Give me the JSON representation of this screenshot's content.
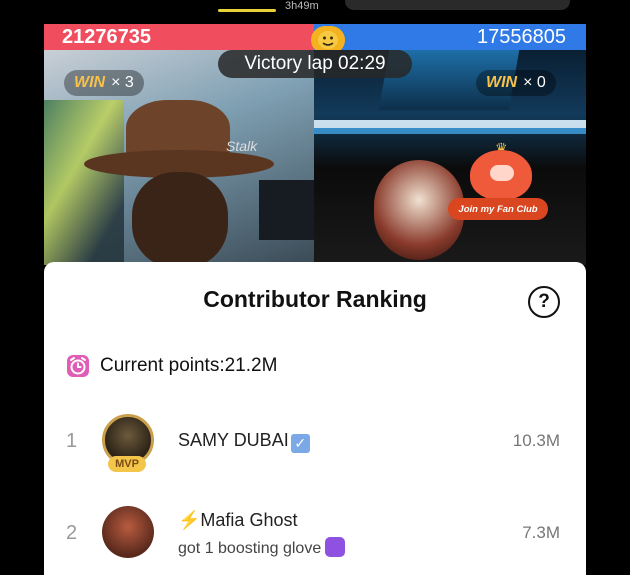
{
  "top": {
    "duration": "3h49m"
  },
  "battle": {
    "left_score": "21276735",
    "right_score": "17556805",
    "timer_label": "Victory lap 02:29",
    "left_win_word": "WIN",
    "left_win_count": "× 3",
    "right_win_word": "WIN",
    "right_win_count": "× 0",
    "fan_club_label": "Join my Fan Club",
    "left_sign_text": "Stalk"
  },
  "sheet": {
    "title": "Contributor Ranking",
    "help_icon": "?",
    "current_points": "Current points:21.2M",
    "contributors": [
      {
        "rank": "1",
        "name": "SAMY DUBAI",
        "badge": "MVP",
        "value": "10.3M"
      },
      {
        "rank": "2",
        "name": "Mafia Ghost",
        "prefix_icon": "⚡",
        "subtext": "got 1 boosting glove",
        "value": "7.3M"
      }
    ]
  },
  "colors": {
    "left_team": "#f04e5f",
    "right_team": "#2f7ae6",
    "win_gold": "#f8c14a",
    "alarm_icon": "#e05db5"
  }
}
